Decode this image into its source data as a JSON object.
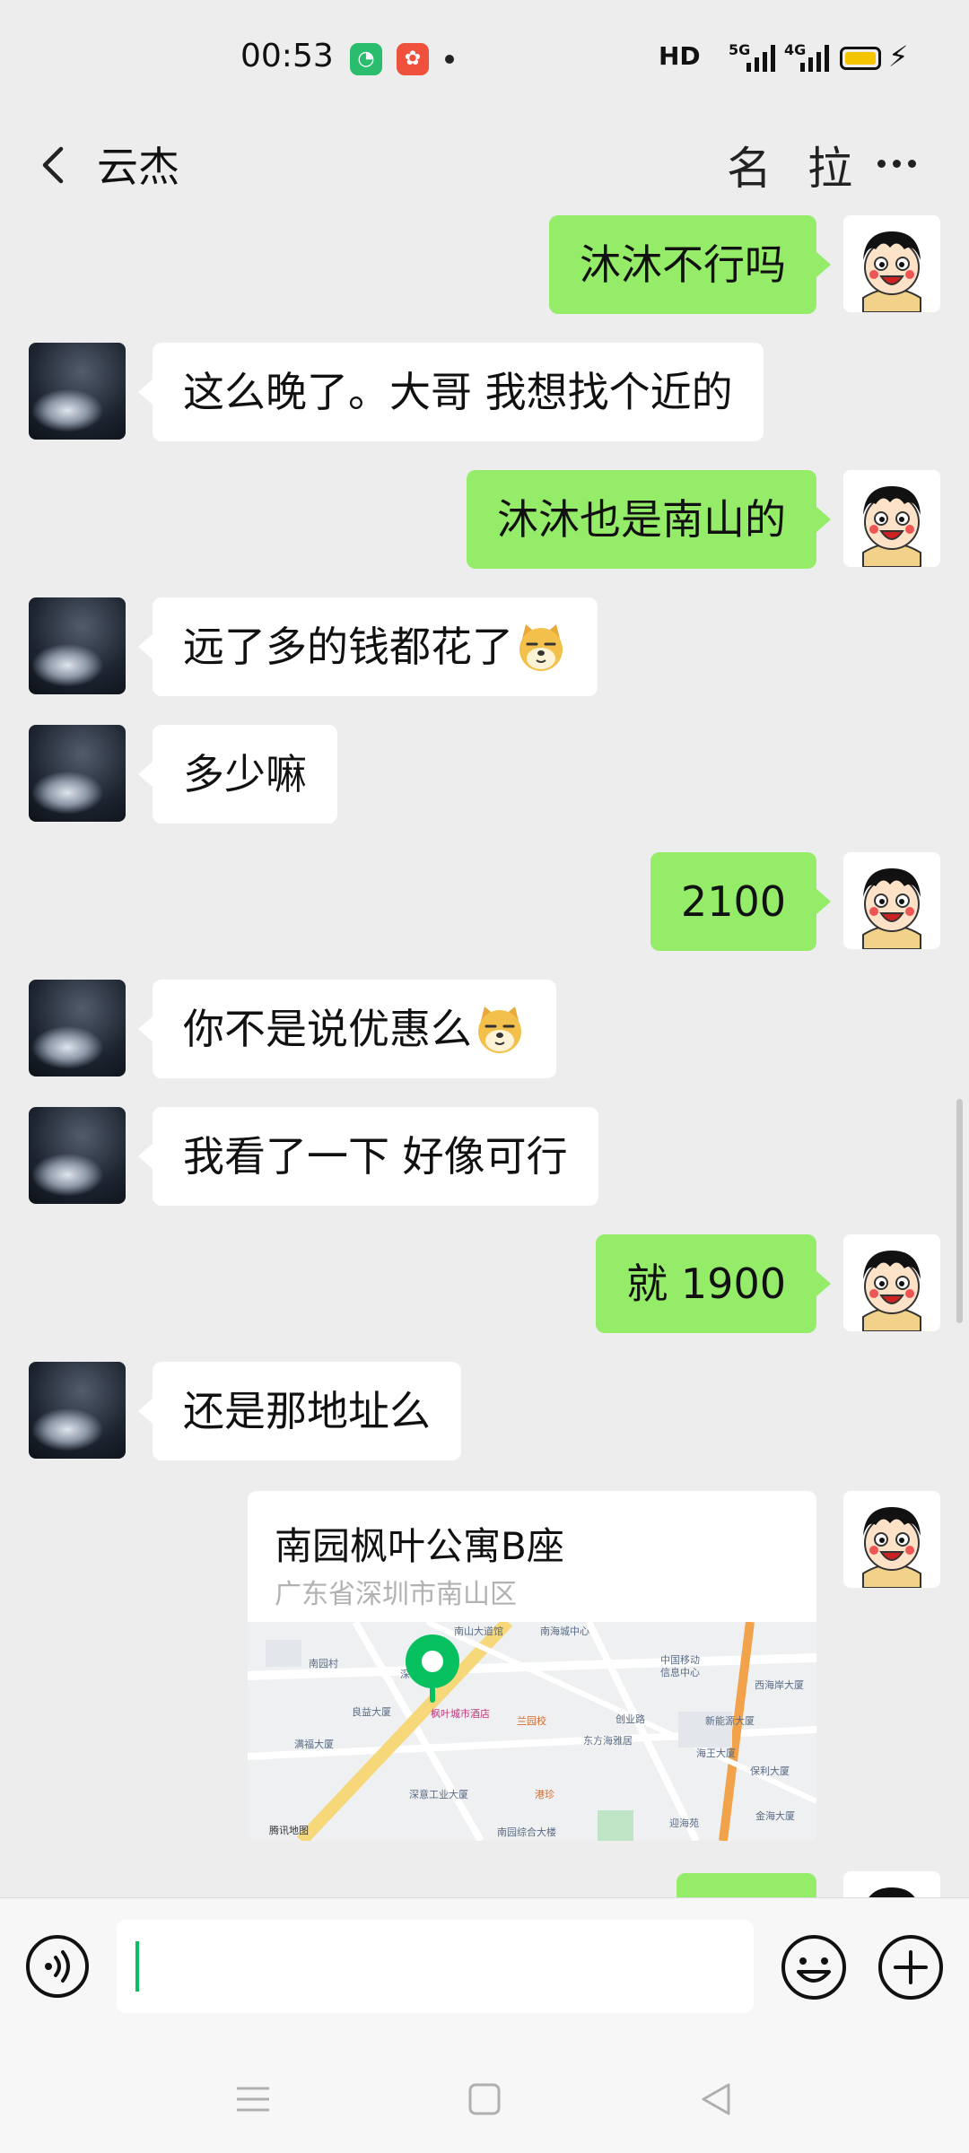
{
  "status_bar": {
    "time": "00:53",
    "hd": "HD",
    "net1": "5G",
    "net2": "4G",
    "battery_color": "#f5c400"
  },
  "header": {
    "title": "云杰",
    "btn1": "名",
    "btn2": "拉",
    "back_icon": "chevron-left-icon",
    "more_icon": "more-dots-icon"
  },
  "messages": [
    {
      "side": "out",
      "text": "沐沐不行吗"
    },
    {
      "side": "in",
      "text": "这么晚了。大哥 我想找个近的"
    },
    {
      "side": "out",
      "text": "沐沐也是南山的"
    },
    {
      "side": "in",
      "text": "远了多的钱都花了",
      "emoji": "doge"
    },
    {
      "side": "in",
      "text": "多少嘛"
    },
    {
      "side": "out",
      "text": "2100"
    },
    {
      "side": "in",
      "text": "你不是说优惠么",
      "emoji": "doge"
    },
    {
      "side": "in",
      "text": "我看了一下 好像可行"
    },
    {
      "side": "out",
      "text": "就 1900"
    },
    {
      "side": "in",
      "text": "还是那地址么"
    }
  ],
  "location": {
    "name": "南园枫叶公寓B座",
    "address": "广东省深圳市南山区",
    "map_labels": [
      "南山大道馆",
      "南海城中心",
      "南园村",
      "深华园",
      "枫叶城市酒店",
      "中国移动",
      "信息中心",
      "西海岸大厦",
      "良益大厦",
      "兰园校",
      "创业路",
      "新能源大厦",
      "满福大厦",
      "东方海雅居",
      "海王大厦",
      "保利大厦",
      "深意工业大厦",
      "港珍",
      "南园综合大楼",
      "迎海苑",
      "金海大厦"
    ],
    "map_brand": "腾讯地图"
  },
  "composer": {
    "placeholder": "",
    "voice_icon": "voice-icon",
    "emoji_icon": "smiley-icon",
    "plus_icon": "plus-icon"
  },
  "colors": {
    "bg": "#ededed",
    "out_bubble": "#95ec69",
    "in_bubble": "#ffffff",
    "accent": "#07c160"
  }
}
